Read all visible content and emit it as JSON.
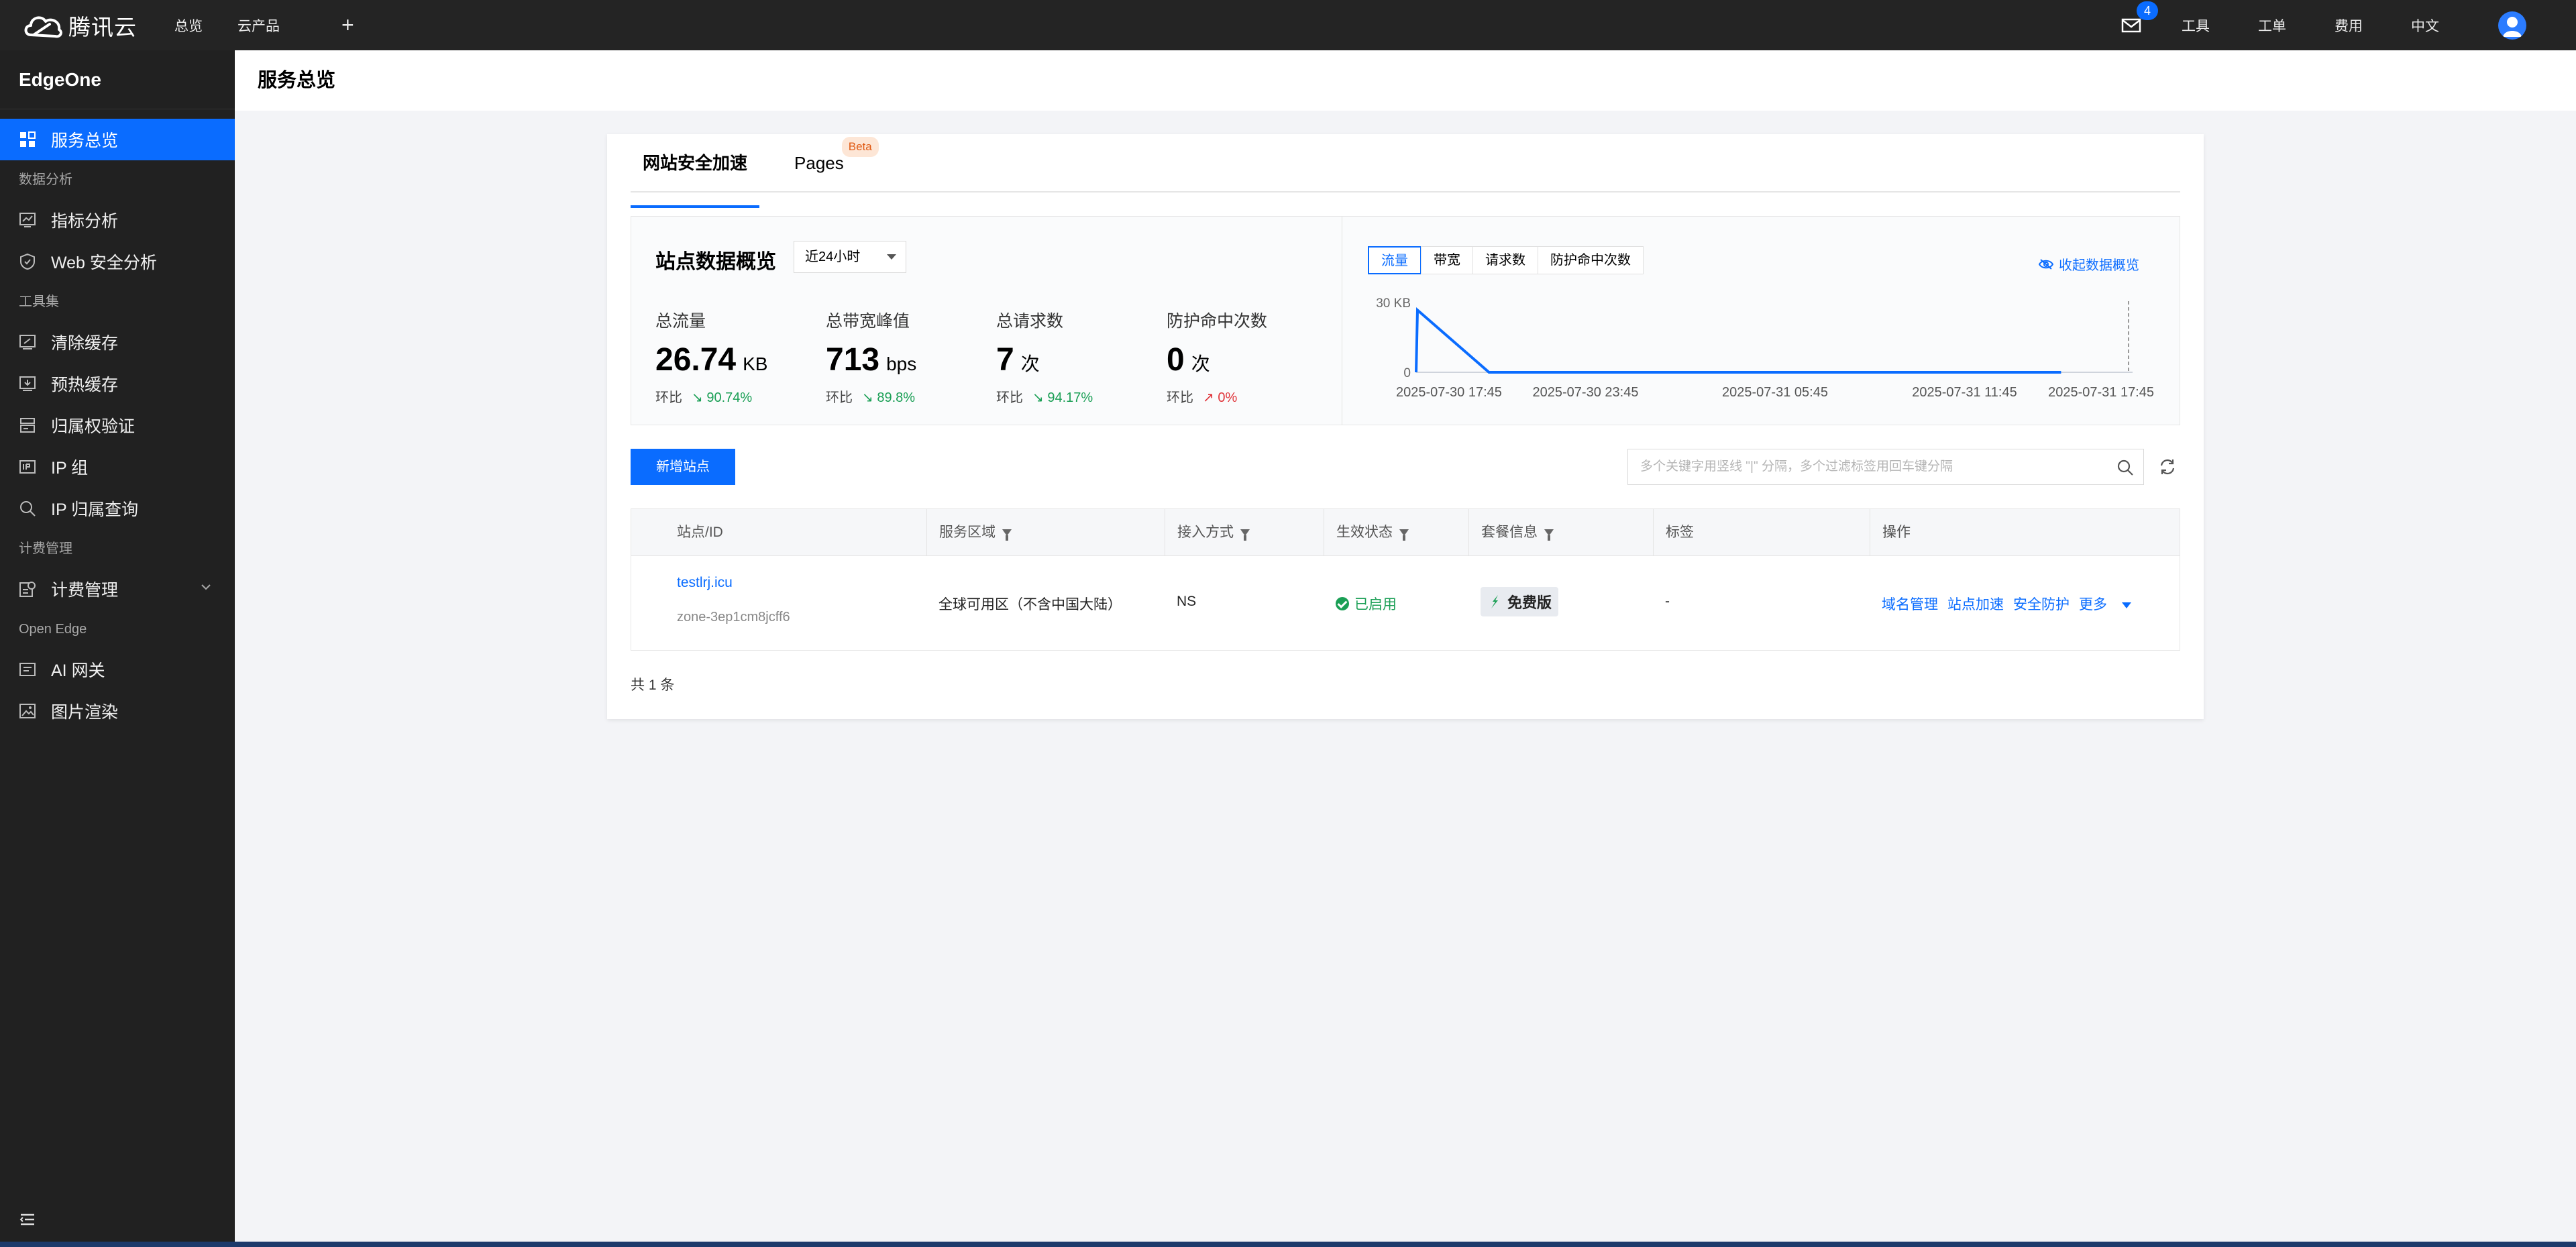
{
  "topbar": {
    "brand": "腾讯云",
    "nav": [
      "总览",
      "云产品"
    ],
    "plus": "+",
    "mail_badge": "4",
    "right_items": [
      "工具",
      "工单",
      "费用",
      "中文"
    ]
  },
  "sidebar": {
    "product": "EdgeOne",
    "items": [
      {
        "type": "item",
        "label": "服务总览",
        "icon": "grid-icon",
        "active": true
      },
      {
        "type": "group",
        "label": "数据分析"
      },
      {
        "type": "item",
        "label": "指标分析",
        "icon": "chart-icon"
      },
      {
        "type": "item",
        "label": "Web 安全分析",
        "icon": "shield-icon"
      },
      {
        "type": "group",
        "label": "工具集"
      },
      {
        "type": "item",
        "label": "清除缓存",
        "icon": "clear-cache-icon"
      },
      {
        "type": "item",
        "label": "预热缓存",
        "icon": "prefetch-icon"
      },
      {
        "type": "item",
        "label": "归属权验证",
        "icon": "ownership-icon"
      },
      {
        "type": "item",
        "label": "IP 组",
        "icon": "ip-group-icon"
      },
      {
        "type": "item",
        "label": "IP 归属查询",
        "icon": "search-icon"
      },
      {
        "type": "group",
        "label": "计费管理"
      },
      {
        "type": "item",
        "label": "计费管理",
        "icon": "billing-icon",
        "expandable": true
      },
      {
        "type": "group",
        "label": "Open Edge"
      },
      {
        "type": "item",
        "label": "AI 网关",
        "icon": "ai-gateway-icon"
      },
      {
        "type": "item",
        "label": "图片渲染",
        "icon": "image-icon"
      }
    ]
  },
  "page": {
    "title": "服务总览"
  },
  "tabs": [
    {
      "label": "网站安全加速",
      "active": true
    },
    {
      "label": "Pages",
      "badge": "Beta"
    }
  ],
  "overview": {
    "title": "站点数据概览",
    "range": "近24小时",
    "metrics": [
      {
        "label": "总流量",
        "value": "26.74",
        "unit": "KB",
        "cmp_label": "环比",
        "arrow": "↘",
        "change": "90.74%",
        "trend": "down"
      },
      {
        "label": "总带宽峰值",
        "value": "713",
        "unit": "bps",
        "cmp_label": "环比",
        "arrow": "↘",
        "change": "89.8%",
        "trend": "down"
      },
      {
        "label": "总请求数",
        "value": "7",
        "unit": "次",
        "cmp_label": "环比",
        "arrow": "↘",
        "change": "94.17%",
        "trend": "down"
      },
      {
        "label": "防护命中次数",
        "value": "0",
        "unit": "次",
        "cmp_label": "环比",
        "arrow": "↗",
        "change": "0%",
        "trend": "up"
      }
    ],
    "chart_tabs": [
      "流量",
      "带宽",
      "请求数",
      "防护命中次数"
    ],
    "collapse_label": "收起数据概览"
  },
  "chart_data": {
    "type": "line",
    "y_ticks": [
      "30 KB",
      "0"
    ],
    "x_ticks": [
      "2025-07-30 17:45",
      "2025-07-30 23:45",
      "2025-07-31 05:45",
      "2025-07-31 11:45",
      "2025-07-31 17:45"
    ],
    "series": [
      {
        "values": [
          0,
          26.74,
          0,
          0,
          0,
          0,
          0,
          0,
          0,
          0,
          0
        ]
      }
    ],
    "ylim": [
      0,
      30
    ],
    "color": "#0a6cff"
  },
  "toolbar": {
    "add_label": "新增站点",
    "search_placeholder": "多个关键字用竖线 \"|\" 分隔，多个过滤标签用回车键分隔"
  },
  "table": {
    "columns": [
      "站点/ID",
      "服务区域",
      "接入方式",
      "生效状态",
      "套餐信息",
      "标签",
      "操作"
    ],
    "filterable": [
      false,
      true,
      true,
      true,
      true,
      false,
      false
    ],
    "rows": [
      {
        "site": "testlrj.icu",
        "id": "zone-3ep1cm8jcff6",
        "region": "全球可用区（不含中国大陆）",
        "access": "NS",
        "status": "已启用",
        "plan": "免费版",
        "tags": "-",
        "ops": [
          "域名管理",
          "站点加速",
          "安全防护"
        ],
        "more": "更多"
      }
    ]
  },
  "footer": {
    "total": "共 1 条"
  },
  "colors": {
    "accent": "#0a6cff",
    "sidebar_bg": "#212121",
    "success": "#1a9f55",
    "danger": "#e0343a"
  }
}
